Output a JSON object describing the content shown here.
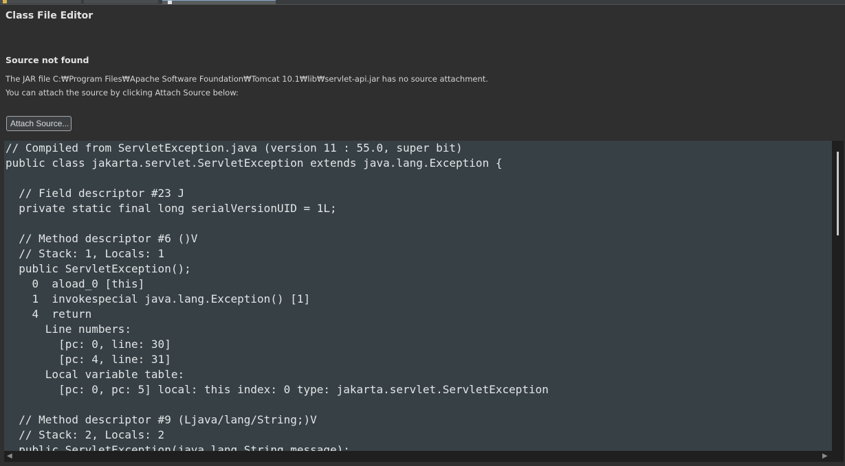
{
  "tabs": [
    {
      "label": ""
    },
    {
      "label": ""
    },
    {
      "label": "",
      "active": true
    }
  ],
  "editor": {
    "title": "Class File Editor",
    "source_not_found": "Source not found",
    "message_line1": "The JAR file C:₩Program Files₩Apache Software Foundation₩Tomcat 10.1₩lib₩servlet-api.jar has no source attachment.",
    "message_line2": "You can attach the source by clicking Attach Source below:",
    "attach_button": "Attach Source..."
  },
  "code_lines": [
    "// Compiled from ServletException.java (version 11 : 55.0, super bit)",
    "public class jakarta.servlet.ServletException extends java.lang.Exception {",
    "",
    "  // Field descriptor #23 J",
    "  private static final long serialVersionUID = 1L;",
    "",
    "  // Method descriptor #6 ()V",
    "  // Stack: 1, Locals: 1",
    "  public ServletException();",
    "    0  aload_0 [this]",
    "    1  invokespecial java.lang.Exception() [1]",
    "    4  return",
    "      Line numbers:",
    "        [pc: 0, line: 30]",
    "        [pc: 4, line: 31]",
    "      Local variable table:",
    "        [pc: 0, pc: 5] local: this index: 0 type: jakarta.servlet.ServletException",
    "",
    "  // Method descriptor #9 (Ljava/lang/String;)V",
    "  // Stack: 2, Locals: 2",
    "  public ServletException(java.lang.String message);"
  ],
  "colors": {
    "background": "#2f2f2f",
    "code_background": "#374045",
    "code_text": "#e2e6e8"
  }
}
